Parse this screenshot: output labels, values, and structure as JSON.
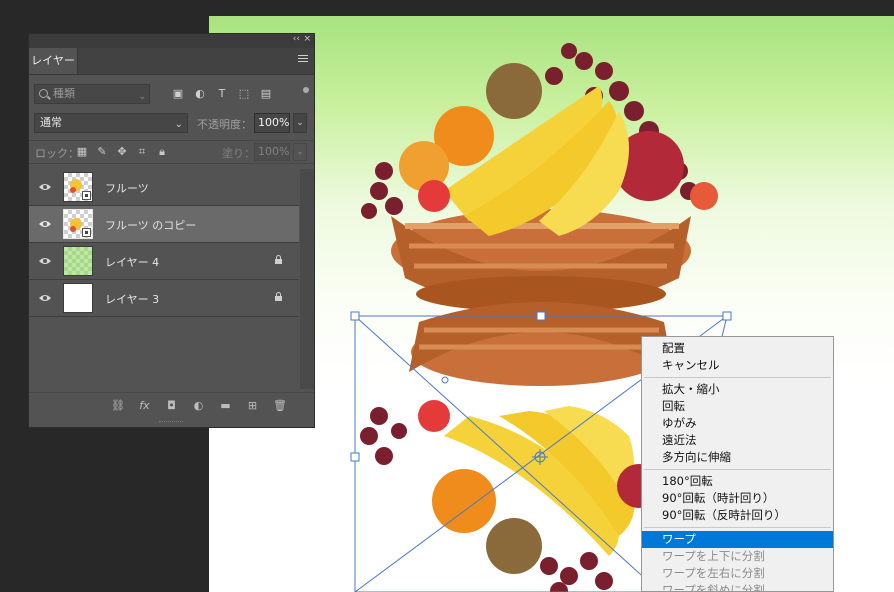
{
  "layers_panel": {
    "collapse_glyph": "‹‹",
    "close_glyph": "×",
    "tab_label": "レイヤー",
    "search_placeholder": "種類",
    "blend_mode": "通常",
    "opacity_label": "不透明度：",
    "opacity_value": "100%",
    "lock_label": "ロック：",
    "fill_label": "塗り：",
    "fill_value": "100%",
    "layers": [
      {
        "name": "フルーツ",
        "thumb": "checker",
        "smart_object": true,
        "locked": false,
        "selected": false
      },
      {
        "name": "フルーツ のコピー",
        "thumb": "checker",
        "smart_object": true,
        "locked": false,
        "selected": true
      },
      {
        "name": "レイヤー 4",
        "thumb": "green",
        "smart_object": false,
        "locked": true,
        "selected": false
      },
      {
        "name": "レイヤー 3",
        "thumb": "white",
        "smart_object": false,
        "locked": true,
        "selected": false
      }
    ]
  },
  "context_menu": {
    "group1": [
      "配置",
      "キャンセル"
    ],
    "group2": [
      "拡大・縮小",
      "回転",
      "ゆがみ",
      "遠近法",
      "多方向に伸縮"
    ],
    "group3": [
      "180°回転",
      "90°回転（時計回り）",
      "90°回転（反時計回り）"
    ],
    "group4": [
      "ワープ",
      "ワープを上下に分割",
      "ワープを左右に分割",
      "ワープを斜めに分割"
    ],
    "highlighted": "ワープ"
  },
  "colors": {
    "accent": "#0078d7",
    "panel_bg": "#535353",
    "canvas_top": "#a8e27f",
    "transform_handle": "#4a78c8"
  }
}
